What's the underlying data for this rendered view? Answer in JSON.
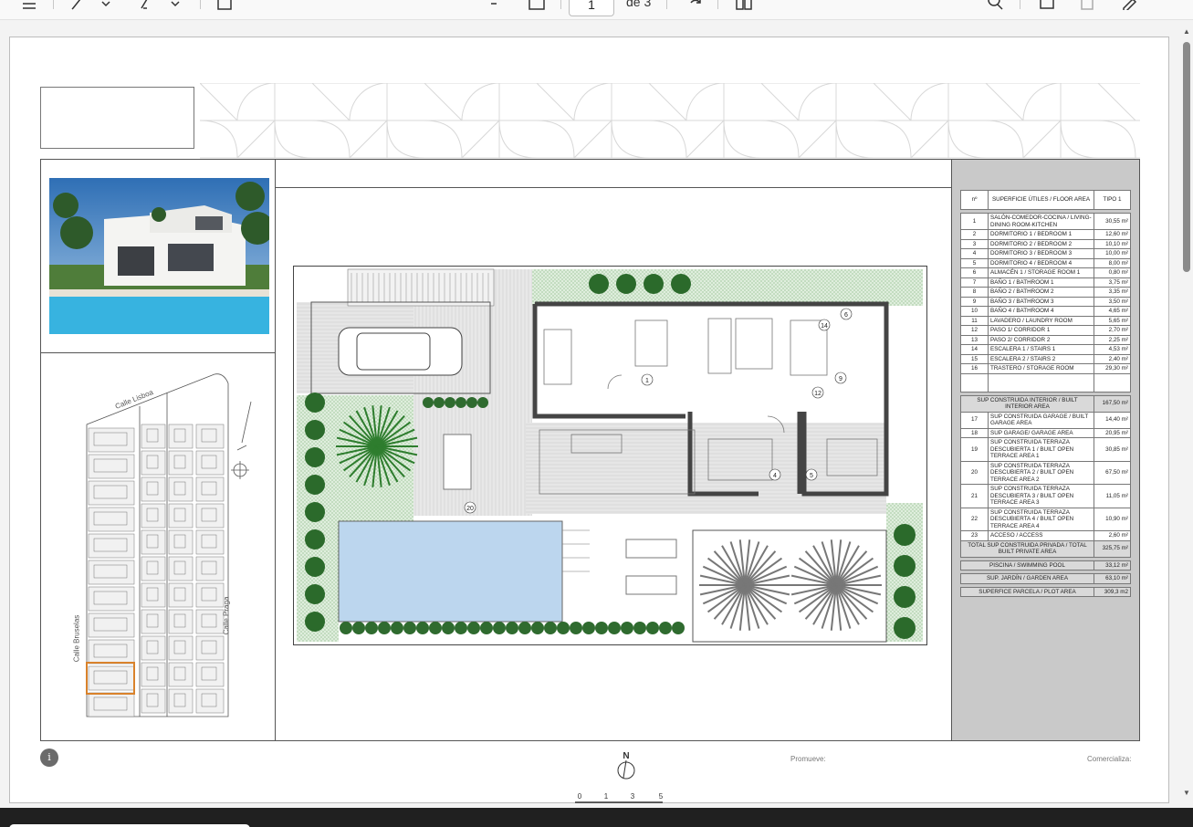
{
  "toolbar": {
    "page_current": "1",
    "page_of": "de 3",
    "tools": [
      "menu-icon",
      "draw-icon",
      "chevron-down-icon",
      "highlight-icon",
      "chevron-down-icon",
      "text-box-icon",
      "minus-icon",
      "fit-page-icon",
      "rotate-icon",
      "two-page-icon",
      "search-icon",
      "print-icon",
      "save-icon",
      "edit-icon"
    ]
  },
  "sheet": {
    "keyplan_streets": {
      "lisboa": "Calle Lisboa",
      "bruselas": "Calle Bruselas",
      "praga": "Calle Praga"
    },
    "plan_labels": [
      "1",
      "4",
      "5",
      "6",
      "9",
      "12",
      "14",
      "20"
    ],
    "footer": {
      "info": "i",
      "north": "N",
      "promueve": "Promueve:",
      "comercializa": "Comercializa:",
      "scale": [
        "0",
        "1",
        "3",
        "5"
      ]
    }
  },
  "area_table": {
    "headers": [
      "nº",
      "SUPERFICIE ÚTILES / FLOOR AREA",
      "TIPO 1"
    ],
    "rooms": [
      {
        "n": "1",
        "name": "SALÓN-COMEDOR-COCINA / LIVING-DINING ROOM-KITCHEN",
        "v": "30,55 m²"
      },
      {
        "n": "2",
        "name": "DORMITORIO 1 / BEDROOM 1",
        "v": "12,60 m²"
      },
      {
        "n": "3",
        "name": "DORMITORIO 2 / BEDROOM 2",
        "v": "10,10 m²"
      },
      {
        "n": "4",
        "name": "DORMITORIO 3 / BEDROOM 3",
        "v": "10,00 m²"
      },
      {
        "n": "5",
        "name": "DORMITORIO 4 / BEDROOM 4",
        "v": "8,00 m²"
      },
      {
        "n": "6",
        "name": "ALMACÉN 1 / STORAGE ROOM 1",
        "v": "0,80 m²"
      },
      {
        "n": "7",
        "name": "BAÑO 1 / BATHROOM 1",
        "v": "3,75 m²"
      },
      {
        "n": "8",
        "name": "BAÑO 2 / BATHROOM 2",
        "v": "3,35 m²"
      },
      {
        "n": "9",
        "name": "BAÑO 3 / BATHROOM 3",
        "v": "3,50 m²"
      },
      {
        "n": "10",
        "name": "BAÑO 4 / BATHROOM 4",
        "v": "4,65 m²"
      },
      {
        "n": "11",
        "name": "LAVADERO / LAUNDRY ROOM",
        "v": "5,65 m²"
      },
      {
        "n": "12",
        "name": "PASO 1/ CORRIDOR 1",
        "v": "2,70 m²"
      },
      {
        "n": "13",
        "name": "PASO 2/ CORRIDOR 2",
        "v": "2,25 m²"
      },
      {
        "n": "14",
        "name": "ESCALERA 1 / STAIRS 1",
        "v": "4,53 m²"
      },
      {
        "n": "15",
        "name": "ESCALERA 2 / STAIRS 2",
        "v": "2,40 m²"
      },
      {
        "n": "16",
        "name": "TRASTERO / STORAGE ROOM",
        "v": "29,30 m²"
      }
    ],
    "interior_total": {
      "label": "SUP CONSTRUIDA INTERIOR / BUILT INTERIOR AREA",
      "v": "167,50 m²"
    },
    "built": [
      {
        "n": "17",
        "name": "SUP CONSTRUIDA GARAGE / BUILT GARAGE AREA",
        "v": "14,40 m²"
      },
      {
        "n": "18",
        "name": "SUP GARAGE/ GARAGE AREA",
        "v": "20,95 m²"
      },
      {
        "n": "19",
        "name": "SUP CONSTRUIDA TERRAZA DESCUBIERTA 1 / BUILT OPEN TERRACE AREA 1",
        "v": "30,85 m²"
      },
      {
        "n": "20",
        "name": "SUP CONSTRUIDA TERRAZA DESCUBIERTA 2 / BUILT OPEN TERRACE AREA 2",
        "v": "67,50 m²"
      },
      {
        "n": "21",
        "name": "SUP CONSTRUIDA TERRAZA DESCUBIERTA 3 / BUILT OPEN TERRACE AREA 3",
        "v": "11,05 m²"
      },
      {
        "n": "22",
        "name": "SUP CONSTRUIDA TERRAZA DESCUBIERTA 4 / BUILT OPEN TERRACE AREA 4",
        "v": "10,90 m²"
      },
      {
        "n": "23",
        "name": "ACCESO / ACCESS",
        "v": "2,60 m²"
      }
    ],
    "private_total": {
      "label": "TOTAL SUP CONSTRUIDA PRIVADA / TOTAL BUILT PRIVATE AREA",
      "v": "325,75 m²"
    },
    "pool": {
      "label": "PISCINA / SWIMMING POOL",
      "v": "33,12 m²"
    },
    "garden": {
      "label": "SUP. JARDÍN / GARDEN AREA",
      "v": "63,10 m²"
    },
    "plot": {
      "label": "SUPERFICE PARCELA / PLOT AREA",
      "v": "309,3 m2"
    }
  }
}
